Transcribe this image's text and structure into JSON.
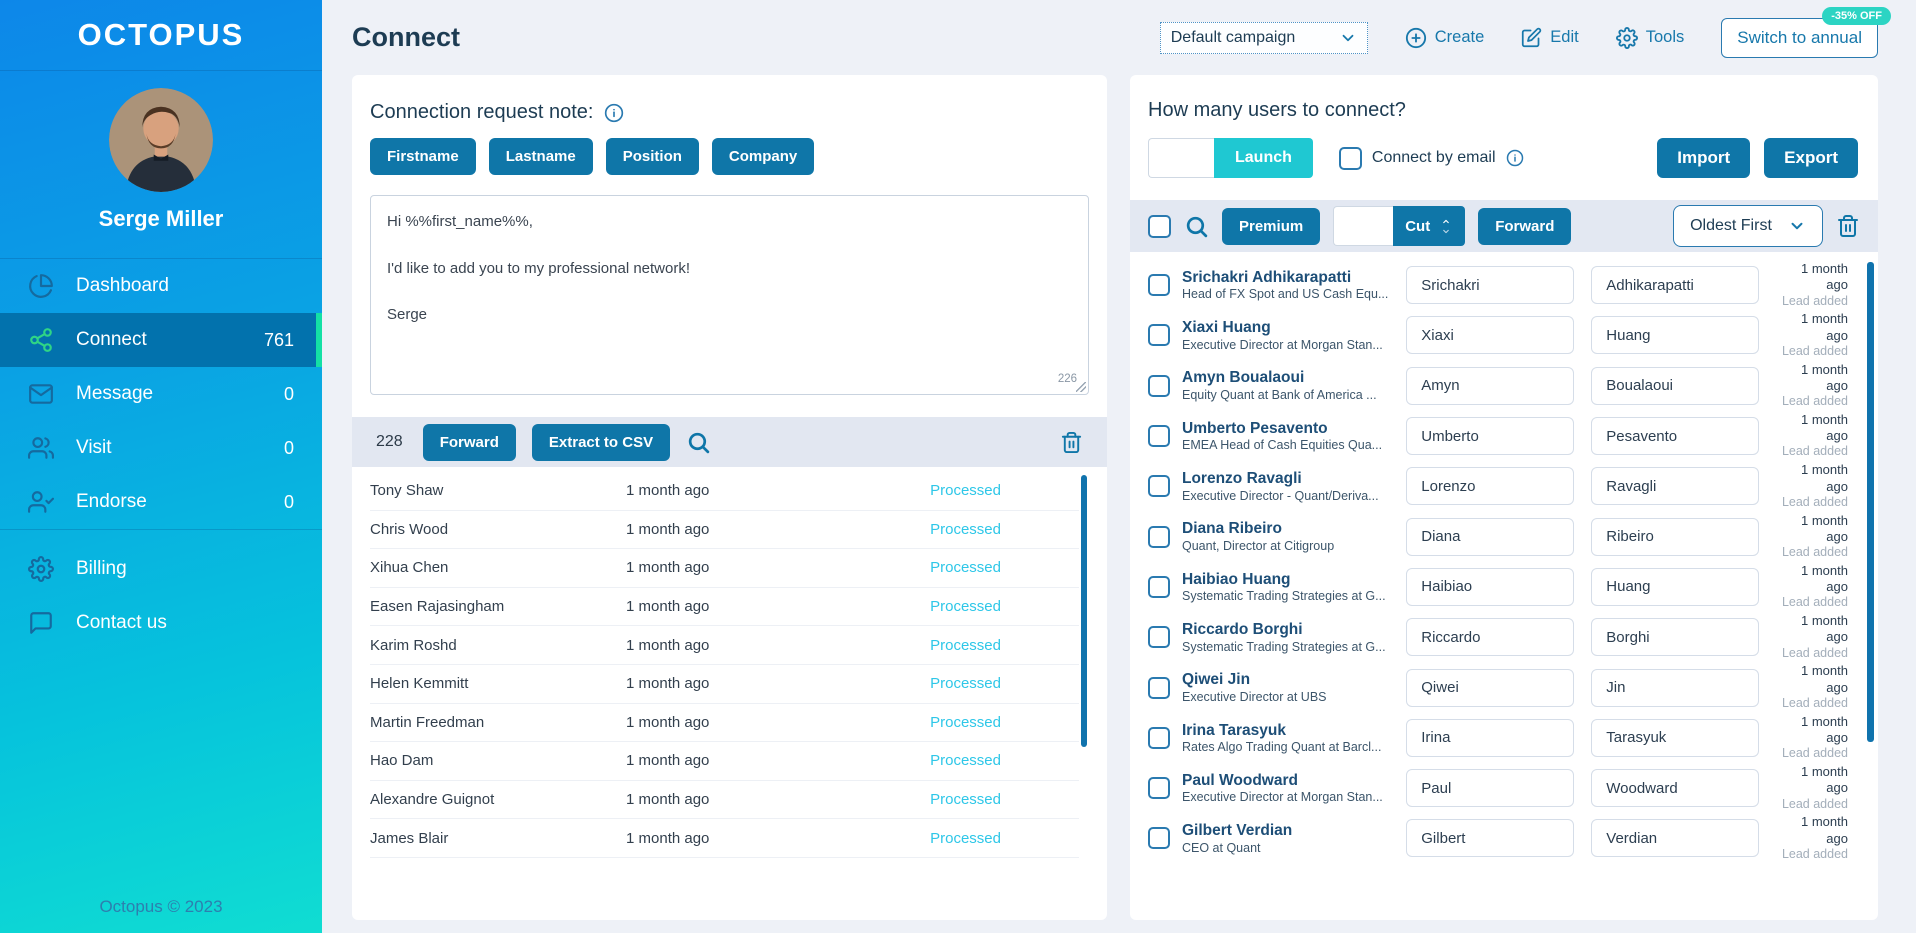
{
  "colors": {
    "primary_button": "#0f76a8",
    "sidebar_gradient_top": "#0d87e9",
    "sidebar_gradient_bottom": "#10ddd2",
    "active_menu_bg": "#0272ad",
    "active_menu_strip": "#14e0a5",
    "launch_button": "#1fc8d2",
    "processed_status": "#2ec7e8",
    "discount_badge": "#2cd4c3",
    "page_background": "#eef1f7"
  },
  "sidebar": {
    "logo": "OCTOPUS",
    "user_name": "Serge Miller",
    "items": [
      {
        "label": "Dashboard",
        "icon": "dashboard-icon",
        "count": "",
        "active": false
      },
      {
        "label": "Connect",
        "icon": "share-icon",
        "count": "761",
        "active": true
      },
      {
        "label": "Message",
        "icon": "envelope-icon",
        "count": "0",
        "active": false
      },
      {
        "label": "Visit",
        "icon": "users-icon",
        "count": "0",
        "active": false
      },
      {
        "label": "Endorse",
        "icon": "user-check-icon",
        "count": "0",
        "active": false
      }
    ],
    "footer_items": [
      {
        "label": "Billing",
        "icon": "gear-icon"
      },
      {
        "label": "Contact us",
        "icon": "chat-icon"
      }
    ],
    "copyright": "Octopus © 2023"
  },
  "header": {
    "title": "Connect",
    "campaign_select_value": "Default campaign",
    "create_label": "Create",
    "edit_label": "Edit",
    "tools_label": "Tools",
    "switch_annual_label": "Switch to annual",
    "discount_badge": "-35% OFF"
  },
  "note_panel": {
    "title": "Connection request note:",
    "placeholder_buttons": [
      {
        "label": "Firstname"
      },
      {
        "label": "Lastname"
      },
      {
        "label": "Position"
      },
      {
        "label": "Company"
      }
    ],
    "message": "Hi %%first_name%%,\n\nI'd like to add you to my professional network!\n\nSerge",
    "char_count": "226",
    "queue_count": "228",
    "forward_label": "Forward",
    "extract_label": "Extract to CSV",
    "rows": [
      {
        "name": "Tony Shaw",
        "time": "1 month ago",
        "status": "Processed"
      },
      {
        "name": "Chris Wood",
        "time": "1 month ago",
        "status": "Processed"
      },
      {
        "name": "Xihua Chen",
        "time": "1 month ago",
        "status": "Processed"
      },
      {
        "name": "Easen Rajasingham",
        "time": "1 month ago",
        "status": "Processed"
      },
      {
        "name": "Karim Roshd",
        "time": "1 month ago",
        "status": "Processed"
      },
      {
        "name": "Helen Kemmitt",
        "time": "1 month ago",
        "status": "Processed"
      },
      {
        "name": "Martin Freedman",
        "time": "1 month ago",
        "status": "Processed"
      },
      {
        "name": "Hao Dam",
        "time": "1 month ago",
        "status": "Processed"
      },
      {
        "name": "Alexandre Guignot",
        "time": "1 month ago",
        "status": "Processed"
      },
      {
        "name": "James Blair",
        "time": "1 month ago",
        "status": "Processed"
      }
    ]
  },
  "connect_panel": {
    "title": "How many users to connect?",
    "launch_input_value": "",
    "launch_label": "Launch",
    "connect_by_email_label": "Connect by email",
    "import_label": "Import",
    "export_label": "Export",
    "premium_label": "Premium",
    "cut_input_value": "",
    "cut_label": "Cut",
    "forward_label": "Forward",
    "sort_select_value": "Oldest First",
    "users": [
      {
        "name": "Srichakri Adhikarapatti",
        "title": "Head of FX Spot and US Cash Equ...",
        "first": "Srichakri",
        "last": "Adhikarapatti",
        "time": "1 month ago",
        "status": "Lead added"
      },
      {
        "name": "Xiaxi Huang",
        "title": "Executive Director at Morgan Stan...",
        "first": "Xiaxi",
        "last": "Huang",
        "time": "1 month ago",
        "status": "Lead added"
      },
      {
        "name": "Amyn Boualaoui",
        "title": "Equity Quant at Bank of America ...",
        "first": "Amyn",
        "last": "Boualaoui",
        "time": "1 month ago",
        "status": "Lead added"
      },
      {
        "name": "Umberto Pesavento",
        "title": "EMEA Head of Cash Equities Qua...",
        "first": "Umberto",
        "last": "Pesavento",
        "time": "1 month ago",
        "status": "Lead added"
      },
      {
        "name": "Lorenzo Ravagli",
        "title": "Executive Director - Quant/Deriva...",
        "first": "Lorenzo",
        "last": "Ravagli",
        "time": "1 month ago",
        "status": "Lead added"
      },
      {
        "name": "Diana Ribeiro",
        "title": "Quant, Director at Citigroup",
        "first": "Diana",
        "last": "Ribeiro",
        "time": "1 month ago",
        "status": "Lead added"
      },
      {
        "name": "Haibiao Huang",
        "title": "Systematic Trading Strategies at G...",
        "first": "Haibiao",
        "last": "Huang",
        "time": "1 month ago",
        "status": "Lead added"
      },
      {
        "name": "Riccardo Borghi",
        "title": "Systematic Trading Strategies at G...",
        "first": "Riccardo",
        "last": "Borghi",
        "time": "1 month ago",
        "status": "Lead added"
      },
      {
        "name": "Qiwei Jin",
        "title": "Executive Director at UBS",
        "first": "Qiwei",
        "last": "Jin",
        "time": "1 month ago",
        "status": "Lead added"
      },
      {
        "name": "Irina Tarasyuk",
        "title": "Rates Algo Trading Quant at Barcl...",
        "first": "Irina",
        "last": "Tarasyuk",
        "time": "1 month ago",
        "status": "Lead added"
      },
      {
        "name": "Paul Woodward",
        "title": "Executive Director at Morgan Stan...",
        "first": "Paul",
        "last": "Woodward",
        "time": "1 month ago",
        "status": "Lead added"
      },
      {
        "name": "Gilbert Verdian",
        "title": "CEO at Quant",
        "first": "Gilbert",
        "last": "Verdian",
        "time": "1 month ago",
        "status": "Lead added"
      }
    ]
  }
}
